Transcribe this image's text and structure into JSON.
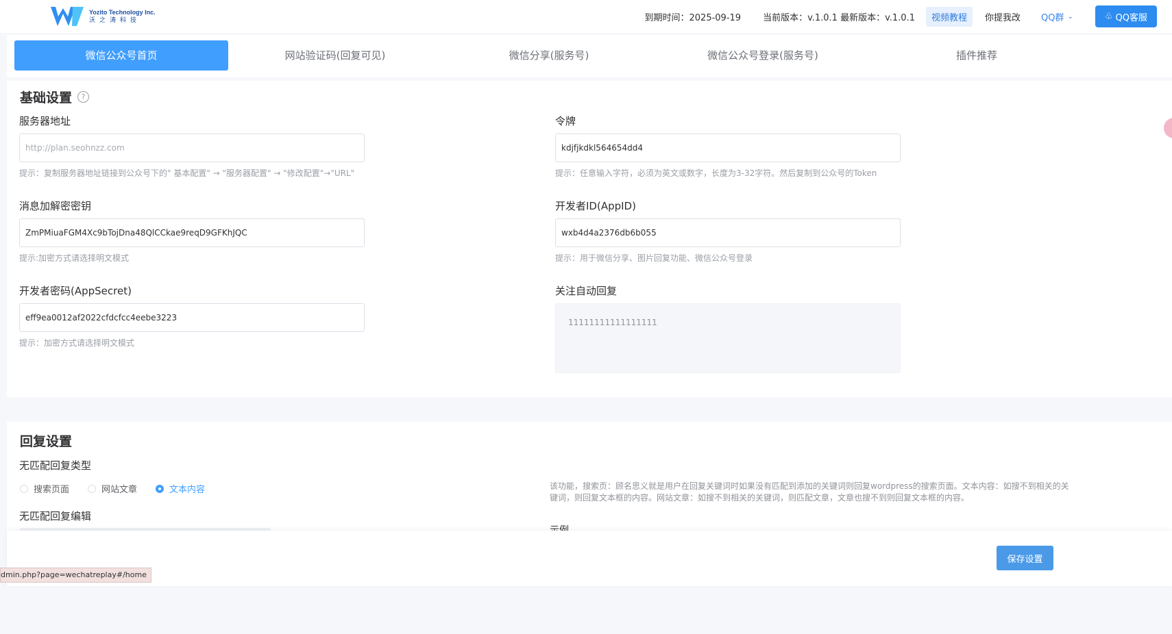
{
  "brand": {
    "en": "Yozito Technology Inc.",
    "cn": "沃之涛科技",
    "primary": "#409eff"
  },
  "topbar": {
    "expiry": "到期时间：2025-09-19",
    "version": "当前版本：v.1.0.1 最新版本：v.1.0.1",
    "video_tutorial": "视频教程",
    "suggest": "你提我改",
    "qq_group": "QQ群",
    "qq_service": "QQ客服"
  },
  "tabs": [
    "微信公众号首页",
    "网站验证码(回复可见)",
    "微信分享(服务号)",
    "微信公众号登录(服务号)",
    "插件推荐"
  ],
  "basic": {
    "title": "基础设置",
    "server_label": "服务器地址",
    "server_placeholder": "http://plan.seohnzz.com",
    "server_hint": "提示：复制服务器地址链接到公众号下的\" 基本配置\" → \"服务器配置\" → \"修改配置\"→\"URL\"",
    "token_label": "令牌",
    "token_value": "kdjfjkdkl564654dd4",
    "token_hint": "提示：任意输入字符，必须为英文或数字，长度为3-32字符。然后复制到公众号的Token",
    "aes_label": "消息加解密密钥",
    "aes_value": "ZmPMiuaFGM4Xc9bTojDna48QlCCkae9reqD9GFKhJQC",
    "aes_hint": "提示:加密方式请选择明文模式",
    "appid_label": "开发者ID(AppID)",
    "appid_value": "wxb4d4a2376db6b055",
    "appid_hint": "提示：用于微信分享、图片回复功能、微信公众号登录",
    "secret_label": "开发者密码(AppSecret)",
    "secret_value": "eff9ea0012af2022cfdcfcc4eebe3223",
    "secret_hint": "提示：加密方式请选择明文模式",
    "follow_label": "关注自动回复",
    "follow_value": "11111111111111111"
  },
  "reply": {
    "title": "回复设置",
    "type_label": "无匹配回复类型",
    "options": [
      "搜索页面",
      "网站文章",
      "文本内容"
    ],
    "selected": "文本内容",
    "description": "该功能，搜索页：顾名思义就是用户在回复关键词时如果没有匹配到添加的关键词则回复wordpress的搜索页面。文本内容：如搜不到相关的关键词，则回复文本框的内容。网站文章：如搜不到相关的关键词，则匹配文章，文章也搜不到则回复文本框的内容。",
    "editor_label": "无匹配回复编辑",
    "example_label": "示例"
  },
  "footer": {
    "save": "保存设置"
  },
  "status_url": "dmin.php?page=wechatreplay#/home"
}
